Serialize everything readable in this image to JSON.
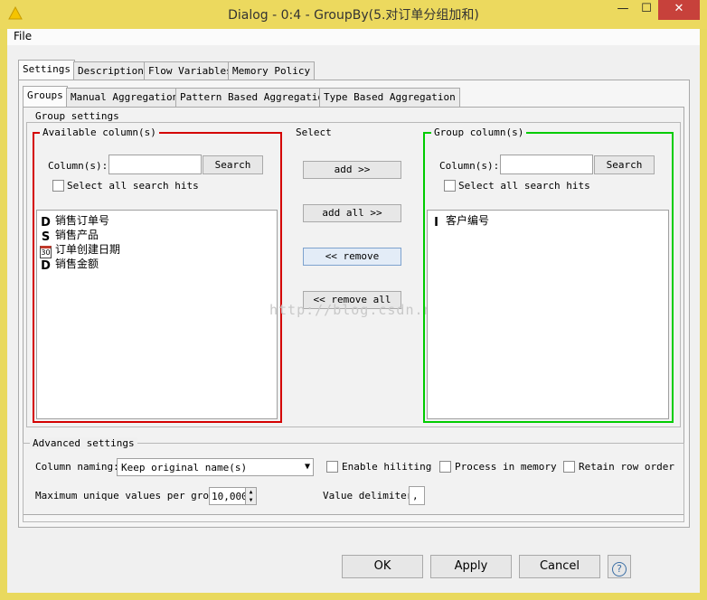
{
  "window": {
    "title": "Dialog - 0:4 - GroupBy(5.对订单分组加和)",
    "minimize": "—",
    "maximize": "☐",
    "close": "✕"
  },
  "menu": {
    "file": "File"
  },
  "tabs": [
    "Settings",
    "Description",
    "Flow Variables",
    "Memory Policy"
  ],
  "subtabs": [
    "Groups",
    "Manual Aggregation",
    "Pattern Based Aggregation",
    "Type Based Aggregation"
  ],
  "group_settings": {
    "legend": "Group settings",
    "available": {
      "legend": "Available column(s)",
      "search_label": "Column(s):",
      "search_value": "",
      "search_button": "Search",
      "select_all_label": "Select all search hits",
      "items": [
        {
          "type": "D",
          "label": "销售订单号"
        },
        {
          "type": "S",
          "label": "销售产品"
        },
        {
          "type": "date",
          "label": "订单创建日期"
        },
        {
          "type": "D",
          "label": "销售金额"
        }
      ]
    },
    "select": {
      "legend": "Select",
      "add": "add >>",
      "add_all": "add all >>",
      "remove": "<< remove",
      "remove_all": "<< remove all"
    },
    "group": {
      "legend": "Group column(s)",
      "search_label": "Column(s):",
      "search_value": "",
      "search_button": "Search",
      "select_all_label": "Select all search hits",
      "items": [
        {
          "type": "I",
          "label": "客户编号"
        }
      ]
    },
    "watermark": "http://blog.csdn.net/"
  },
  "advanced": {
    "legend": "Advanced settings",
    "column_naming_label": "Column naming:",
    "column_naming_value": "Keep original name(s)",
    "enable_hiliting": "Enable hiliting",
    "process_in_memory": "Process in memory",
    "retain_row_order": "Retain row order",
    "max_unique_label": "Maximum unique values per group",
    "max_unique_value": "10,000",
    "value_delimiter_label": "Value delimiter",
    "value_delimiter_value": ","
  },
  "buttons": {
    "ok": "OK",
    "apply": "Apply",
    "cancel": "Cancel",
    "help": "?"
  }
}
